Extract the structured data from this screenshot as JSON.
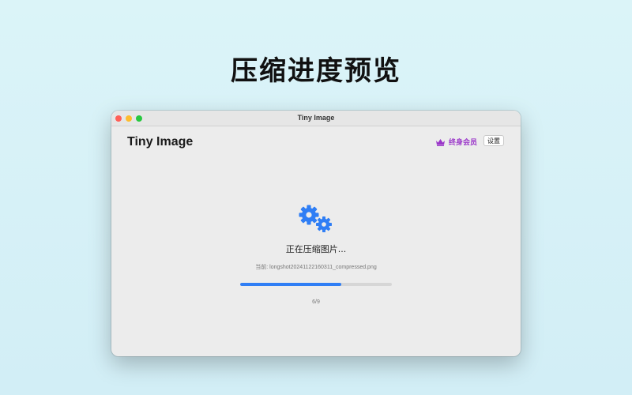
{
  "promo": {
    "title": "压缩进度预览"
  },
  "window": {
    "title": "Tiny Image",
    "app_name": "Tiny Image"
  },
  "header": {
    "membership_label": "终身会员",
    "settings_label": "设置"
  },
  "progress": {
    "status": "正在压缩图片...",
    "current_file": "当前: longshot20241122160311_compressed.png",
    "completed": 6,
    "total": 9,
    "count_text": "6/9"
  },
  "colors": {
    "accent": "#2f7ef5",
    "membership": "#9a36c9",
    "gear": "#2f7ef5"
  },
  "icons": {
    "membership": "crown-icon",
    "status": "gears-icon"
  }
}
